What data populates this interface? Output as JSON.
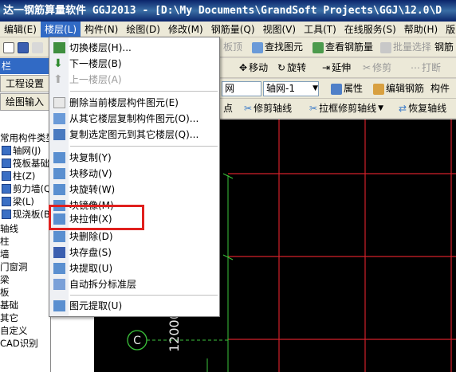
{
  "titlebar": {
    "text": "达一钢筋算量软件 GGJ2013 - [D:\\My Documents\\GrandSoft Projects\\GGJ\\12.0\\D"
  },
  "menubar": {
    "items": [
      "编辑(E)",
      "楼层(L)",
      "构件(N)",
      "绘图(D)",
      "修改(M)",
      "钢筋量(Q)",
      "视图(V)",
      "工具(T)",
      "在线服务(S)",
      "帮助(H)",
      "版"
    ]
  },
  "toolbar1": {
    "items": [
      "板顶",
      "查找图元",
      "查看钢筋量",
      "批量选择",
      "钢筋"
    ]
  },
  "toolbar2": {
    "items": [
      "移动",
      "旋转",
      "延伸",
      "修剪",
      "打断"
    ]
  },
  "toolbar3": {
    "combo1": "网",
    "combo2": "轴网-1",
    "items": [
      "属性",
      "编辑钢筋",
      "构件"
    ]
  },
  "toolbar4": {
    "items": [
      "点",
      "修剪轴线",
      "拉框修剪轴线",
      "恢复轴线"
    ]
  },
  "leftpanel": {
    "title": "栏",
    "btn1": "工程设置",
    "btn2": "绘图输入",
    "tree": [
      "常用构件类型",
      "轴网(J)",
      "筏板基础",
      "柱(Z)",
      "剪力墙(Q)",
      "梁(L)",
      "现浇板(B)",
      "轴线",
      "柱",
      "墙",
      "门窗洞",
      "梁",
      "板",
      "基础",
      "其它",
      "自定义",
      "CAD识别"
    ]
  },
  "dropdown": {
    "items": [
      {
        "label": "切换楼层(H)...",
        "disabled": false
      },
      {
        "label": "下一楼层(B)",
        "disabled": false
      },
      {
        "label": "上一楼层(A)",
        "disabled": true
      },
      {
        "label": "删除当前楼层构件图元(E)",
        "disabled": false
      },
      {
        "label": "从其它楼层复制构件图元(O)...",
        "disabled": false
      },
      {
        "label": "复制选定图元到其它楼层(Q)...",
        "disabled": false
      },
      {
        "label": "块复制(Y)",
        "disabled": false
      },
      {
        "label": "块移动(V)",
        "disabled": false
      },
      {
        "label": "块旋转(W)",
        "disabled": false
      },
      {
        "label": "块镜像(M)",
        "disabled": false
      },
      {
        "label": "块拉伸(X)",
        "disabled": false
      },
      {
        "label": "块删除(D)",
        "disabled": false
      },
      {
        "label": "块存盘(S)",
        "disabled": false
      },
      {
        "label": "块提取(U)",
        "disabled": false
      },
      {
        "label": "自动拆分标准层",
        "disabled": false
      },
      {
        "label": "图元提取(U)",
        "disabled": false
      }
    ]
  },
  "canvas": {
    "axis_label": "C",
    "dimension": "12000"
  },
  "colors": {
    "grid": "#d2202a",
    "axis": "#3cc43c",
    "highlight": "#e0201e",
    "menu_active": "#316ac5"
  }
}
